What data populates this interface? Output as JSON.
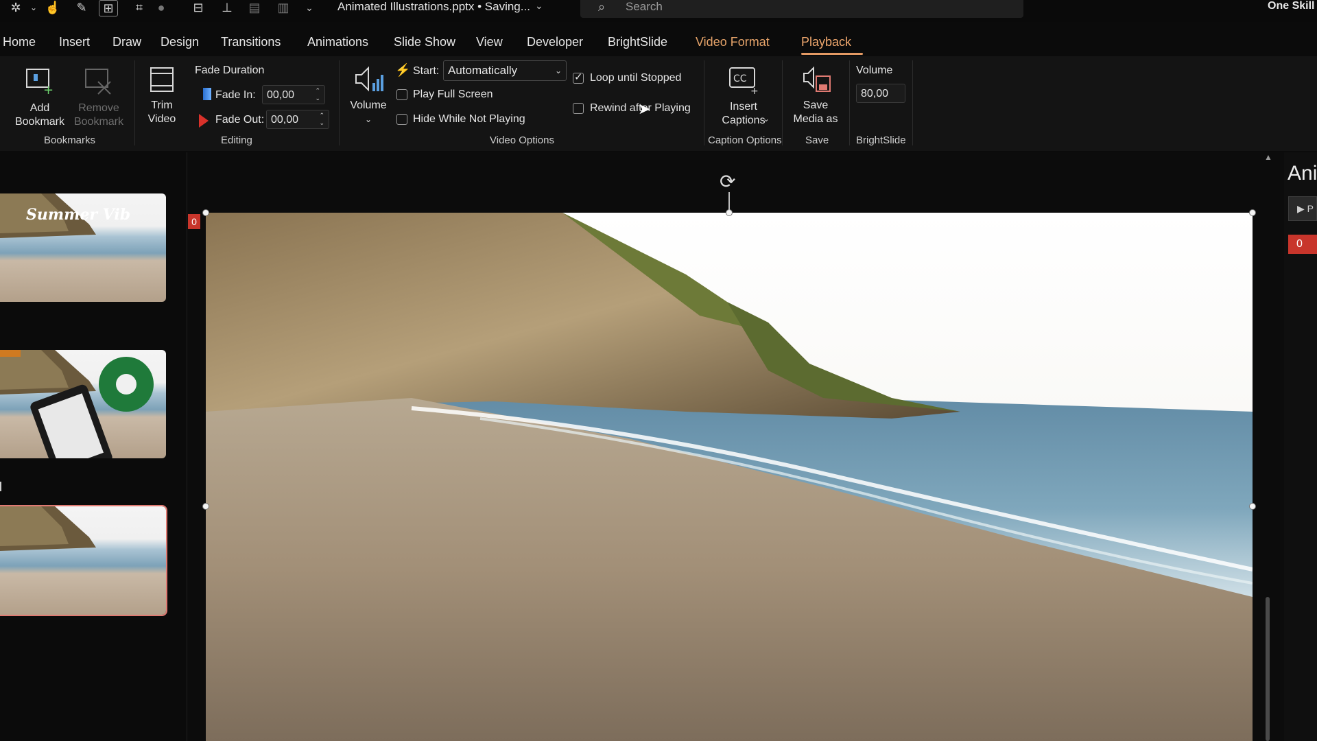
{
  "titlebar": {
    "document_title": "Animated Illustrations.pptx • Saving...",
    "search_placeholder": "Search",
    "user": "One Skill",
    "qat_icons": [
      "pin-icon",
      "touch-icon",
      "draw-icon",
      "insert-icon",
      "crop-icon",
      "record-icon",
      "align-icon",
      "distribute-icon",
      "group-icon",
      "ungroup-icon",
      "more-icon"
    ]
  },
  "tabs": [
    "Home",
    "Insert",
    "Draw",
    "Design",
    "Transitions",
    "Animations",
    "Slide Show",
    "View",
    "Developer",
    "BrightSlide",
    "Video Format",
    "Playback"
  ],
  "active_tab": "Playback",
  "ribbon": {
    "bookmarks": {
      "add_label_1": "Add",
      "add_label_2": "Bookmark",
      "remove_label_1": "Remove",
      "remove_label_2": "Bookmark",
      "group": "Bookmarks"
    },
    "editing": {
      "trim_1": "Trim",
      "trim_2": "Video",
      "fade_duration": "Fade Duration",
      "fade_in_label": "Fade In:",
      "fade_in_value": "00,00",
      "fade_out_label": "Fade Out:",
      "fade_out_value": "00,00",
      "group": "Editing"
    },
    "video_options": {
      "volume": "Volume",
      "start_label": "Start:",
      "start_value": "Automatically",
      "play_full_screen": "Play Full Screen",
      "play_full_screen_checked": false,
      "hide_while_not_playing": "Hide While Not Playing",
      "hide_while_not_playing_checked": false,
      "loop_until_stopped": "Loop until Stopped",
      "loop_until_stopped_checked": true,
      "rewind_after_playing": "Rewind after Playing",
      "rewind_after_playing_checked": false,
      "group": "Video Options"
    },
    "captions": {
      "insert_1": "Insert",
      "insert_2": "Captions",
      "group": "Caption Options"
    },
    "save": {
      "save_1": "Save",
      "save_2": "Media as",
      "group": "Save"
    },
    "brightslide": {
      "volume_label": "Volume",
      "volume_value": "80,00",
      "group": "BrightSlide"
    }
  },
  "thumbnails": [
    {
      "title": "Summer Vib"
    },
    {
      "title": ""
    },
    {
      "title": ""
    }
  ],
  "slide_tag": "0",
  "animation_pane": {
    "title": "Ani",
    "play_label": "P",
    "tag": "0"
  },
  "colors": {
    "accent": "#e49a64",
    "tag_red": "#c8352b"
  }
}
